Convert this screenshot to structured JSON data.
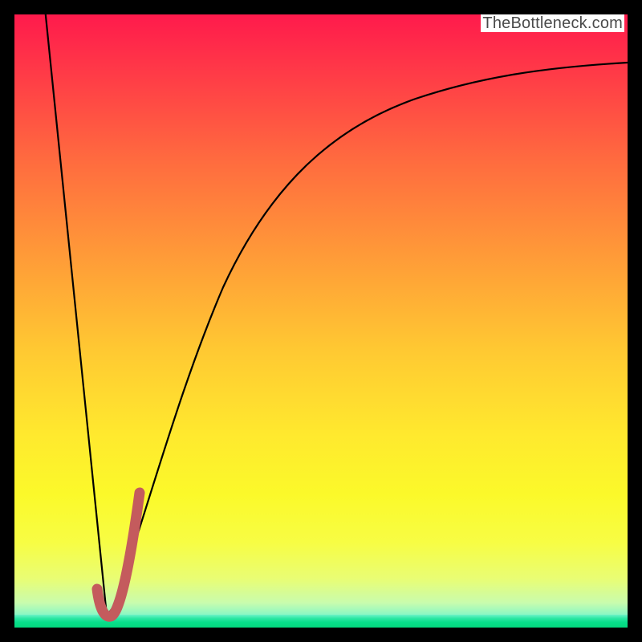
{
  "watermark": "TheBottleneck.com",
  "colors": {
    "frame": "#000000",
    "curve_main": "#000000",
    "accent_stroke": "#c45b5d"
  },
  "chart_data": {
    "type": "line",
    "title": "",
    "xlabel": "",
    "ylabel": "",
    "xlim": [
      0,
      100
    ],
    "ylim": [
      0,
      100
    ],
    "grid": false,
    "legend": false,
    "series": [
      {
        "name": "left-descent",
        "x": [
          5,
          15
        ],
        "y": [
          100,
          2
        ]
      },
      {
        "name": "right-curve",
        "x": [
          15,
          20,
          25,
          30,
          35,
          40,
          45,
          50,
          55,
          60,
          65,
          70,
          75,
          80,
          85,
          90,
          95,
          100
        ],
        "y": [
          2,
          22,
          40,
          53,
          63,
          70,
          75,
          79,
          82,
          84,
          86,
          87,
          88,
          89,
          90,
          90.5,
          91,
          91.5
        ]
      },
      {
        "name": "accent-j",
        "x": [
          14,
          15,
          16,
          18,
          20
        ],
        "y": [
          4,
          2,
          4,
          12,
          22
        ]
      }
    ],
    "gradient_stops": [
      {
        "pct": 0,
        "color": "#ff1a4c"
      },
      {
        "pct": 24,
        "color": "#ff6a3f"
      },
      {
        "pct": 56,
        "color": "#ffc932"
      },
      {
        "pct": 80,
        "color": "#fbf92a"
      },
      {
        "pct": 98,
        "color": "#8af7c4"
      },
      {
        "pct": 100,
        "color": "#04d87e"
      }
    ]
  }
}
